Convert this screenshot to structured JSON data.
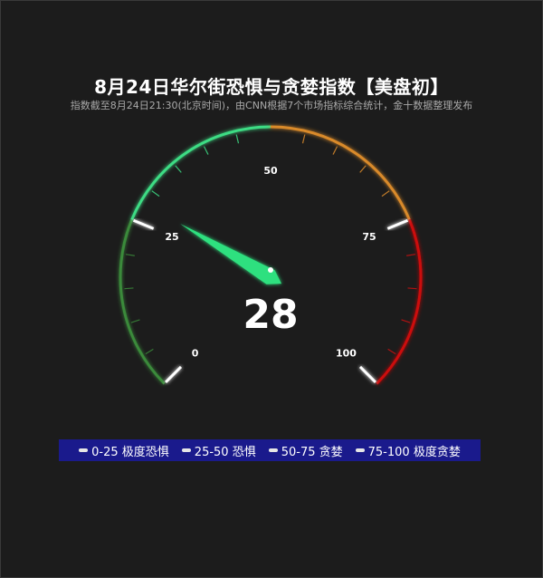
{
  "chart_data": {
    "type": "gauge",
    "title": "8月24日华尔街恐惧与贪婪指数【美盘初】",
    "subtitle": "指数截至8月24日21:30(北京时间)，由CNN根据7个市场指标综合统计，金十数据整理发布",
    "value": 28,
    "value_label": "28",
    "min": 0,
    "max": 100,
    "major_ticks": [
      {
        "value": 0,
        "label": "0"
      },
      {
        "value": 25,
        "label": "25"
      },
      {
        "value": 50,
        "label": "50"
      },
      {
        "value": 75,
        "label": "75"
      },
      {
        "value": 100,
        "label": "100"
      }
    ],
    "bands": [
      {
        "from": 0,
        "to": 25,
        "color": "#3a8a3a"
      },
      {
        "from": 25,
        "to": 50,
        "color": "#3ddc84"
      },
      {
        "from": 50,
        "to": 75,
        "color": "#d98a2b"
      },
      {
        "from": 75,
        "to": 100,
        "color": "#cc1111"
      }
    ],
    "needle_color": "#2ee07f",
    "legend": [
      {
        "label": "0-25 极度恐惧"
      },
      {
        "label": "25-50 恐惧"
      },
      {
        "label": "50-75 贪婪"
      },
      {
        "label": "75-100 极度贪婪"
      }
    ],
    "legend_background": "#1a1a8c"
  }
}
